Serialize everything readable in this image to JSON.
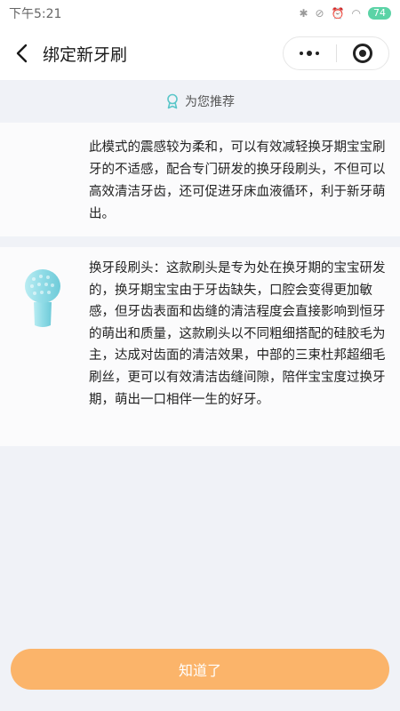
{
  "status_bar": {
    "time": "下午5:21",
    "battery": "74"
  },
  "navbar": {
    "title": "绑定新牙刷"
  },
  "recommend": {
    "label": "为您推荐"
  },
  "mode_card": {
    "description": "此模式的震感较为柔和，可以有效减轻换牙期宝宝刷牙的不适感，配合专门研发的换牙段刷头，不但可以高效清洁牙齿，还可促进牙床血液循环，利于新牙萌出。"
  },
  "brush_head_card": {
    "description": "换牙段刷头：这款刷头是专为处在换牙期的宝宝研发的，换牙期宝宝由于牙齿缺失，口腔会变得更加敏感，但牙齿表面和齿缝的清洁程度会直接影响到恒牙的萌出和质量，这款刷头以不同粗细搭配的硅胶毛为主，达成对齿面的清洁效果，中部的三束杜邦超细毛刷丝，更可以有效清洁齿缝间隙，陪伴宝宝度过换牙期，萌出一口相伴一生的好牙。"
  },
  "footer": {
    "confirm_label": "知道了"
  },
  "colors": {
    "confirm_button": "#fbb46a",
    "page_background": "#f0f2f7",
    "brush_head": "#8fdbe6",
    "recommend_icon": "#5bc6c9"
  }
}
